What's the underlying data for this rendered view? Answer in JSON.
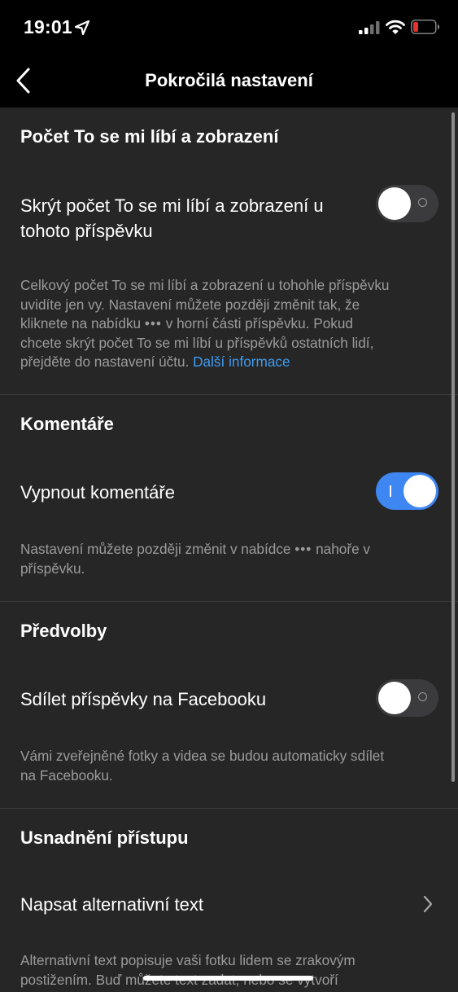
{
  "status": {
    "time": "19:01",
    "icons": [
      "location-arrow-icon",
      "signal-icon",
      "wifi-icon",
      "battery-low-icon"
    ],
    "battery_color": "#e5312f"
  },
  "header": {
    "title": "Pokročilá nastavení",
    "back_icon": "chevron-left-icon"
  },
  "sections": {
    "likes": {
      "heading": "Počet To se mi líbí a zobrazení",
      "row_label_line1": "Skrýt počet To se mi líbí a zobrazení u",
      "row_label_line2": "tohoto příspěvku",
      "toggle_on": false,
      "desc_line1": "Celkový počet To se mi líbí a zobrazení u tohohle příspěvku",
      "desc_line2_a": "uvidíte jen vy. Nastavení můžete později změnit tak, že",
      "desc_line3_a": "kliknete na nabídku",
      "desc_line3_dots": "•••",
      "desc_line3_b": "v horní části příspěvku. Pokud",
      "desc_line4": "chcete skrýt počet To se mi líbí u příspěvků ostatních lidí,",
      "desc_line5_a": "přejděte do nastavení účtu.",
      "desc_link": "Další informace"
    },
    "comments": {
      "heading": "Komentáře",
      "row_label": "Vypnout komentáře",
      "toggle_on": true,
      "desc_line1_a": "Nastavení můžete později změnit v nabídce",
      "desc_line1_dots": "•••",
      "desc_line1_b": "nahoře v",
      "desc_line2": "příspěvku."
    },
    "preferences": {
      "heading": "Předvolby",
      "row_label": "Sdílet příspěvky na Facebooku",
      "toggle_on": false,
      "desc_line1": "Vámi zveřejněné fotky a videa se budou automaticky sdílet",
      "desc_line2": "na Facebooku."
    },
    "accessibility": {
      "heading": "Usnadnění přístupu",
      "row_label": "Napsat alternativní text",
      "row_icon": "chevron-right-icon",
      "desc_line1": "Alternativní text popisuje vaši fotku lidem se zrakovým",
      "desc_line2": "postižením. Buď můžete text zadat, nebo se vytvoří"
    }
  },
  "colors": {
    "background": "#262626",
    "bars": "#000000",
    "accent": "#3e86f1",
    "link": "#3d9bf0",
    "secondary_text": "#9b9b9b"
  }
}
